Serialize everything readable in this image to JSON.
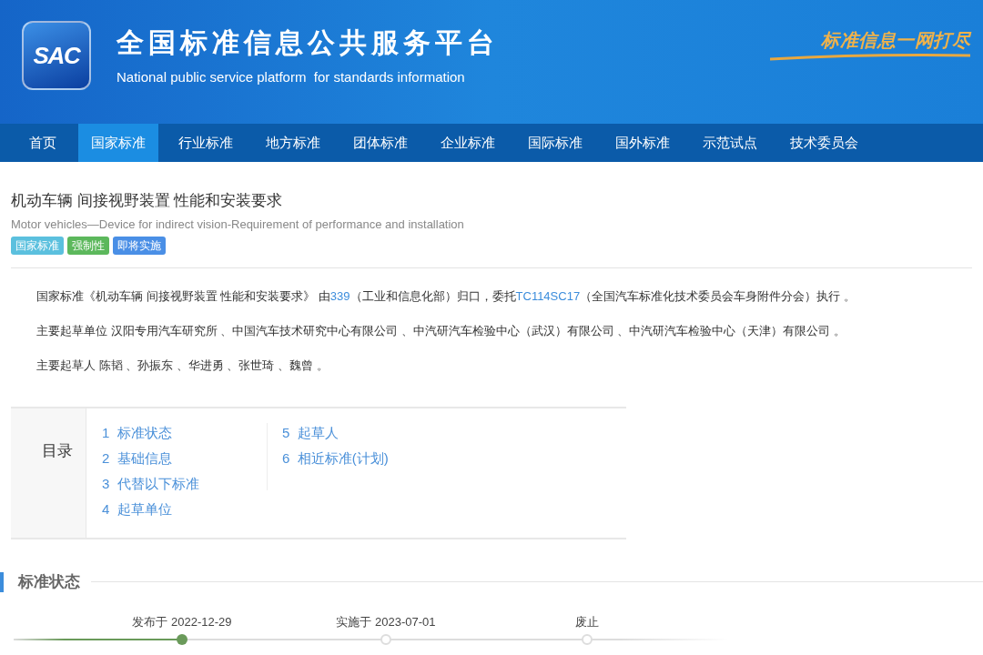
{
  "header": {
    "logo_text": "SAC",
    "title": "全国标准信息公共服务平台",
    "subtitle": "National public service platform  for standards information",
    "slogan": "标准信息一网打尽"
  },
  "nav": [
    {
      "label": "首页",
      "selected": false
    },
    {
      "label": "国家标准",
      "selected": true
    },
    {
      "label": "行业标准",
      "selected": false
    },
    {
      "label": "地方标准",
      "selected": false
    },
    {
      "label": "团体标准",
      "selected": false
    },
    {
      "label": "企业标准",
      "selected": false
    },
    {
      "label": "国际标准",
      "selected": false
    },
    {
      "label": "国外标准",
      "selected": false
    },
    {
      "label": "示范试点",
      "selected": false
    },
    {
      "label": "技术委员会",
      "selected": false
    }
  ],
  "standard": {
    "title": "机动车辆 间接视野装置 性能和安装要求",
    "english_title": "Motor vehicles—Device for indirect vision-Requirement of performance and installation",
    "tags": [
      {
        "label": "国家标准",
        "color": "#5bc0de"
      },
      {
        "label": "强制性",
        "color": "#5cb85c"
      },
      {
        "label": "即将实施",
        "color": "#4a8fe6"
      }
    ]
  },
  "summary": [
    {
      "parts": [
        {
          "kind": "text",
          "text": "国家标准《机动车辆 间接视野装置 性能和安装要求》 由"
        },
        {
          "kind": "link",
          "text": "339"
        },
        {
          "kind": "text",
          "text": "（工业和信息化部）归口，委托"
        },
        {
          "kind": "link",
          "text": "TC114SC17"
        },
        {
          "kind": "text",
          "text": "（全国汽车标准化技术委员会车身附件分会）执行 。"
        }
      ]
    },
    {
      "parts": [
        {
          "kind": "text",
          "text": "主要起草单位 汉阳专用汽车研究所 、中国汽车技术研究中心有限公司 、中汽研汽车检验中心（武汉）有限公司 、中汽研汽车检验中心（天津）有限公司 。"
        }
      ]
    },
    {
      "parts": [
        {
          "kind": "text",
          "text": "主要起草人 陈韬 、孙振东 、华进勇 、张世琦 、魏曾 。"
        }
      ]
    }
  ],
  "toc": {
    "label": "目录",
    "columns": [
      [
        {
          "number": "1",
          "text": "标准状态"
        },
        {
          "number": "2",
          "text": "基础信息"
        },
        {
          "number": "3",
          "text": "代替以下标准"
        },
        {
          "number": "4",
          "text": "起草单位"
        }
      ],
      [
        {
          "number": "5",
          "text": "起草人"
        },
        {
          "number": "6",
          "text": "相近标准(计划)"
        }
      ]
    ]
  },
  "status_section": {
    "heading": "标准状态",
    "steps": [
      {
        "label": "发布于 2022-12-29",
        "reached": true
      },
      {
        "label": "实施于 2023-07-01",
        "reached": false
      },
      {
        "label": "废止",
        "reached": false
      }
    ]
  }
}
